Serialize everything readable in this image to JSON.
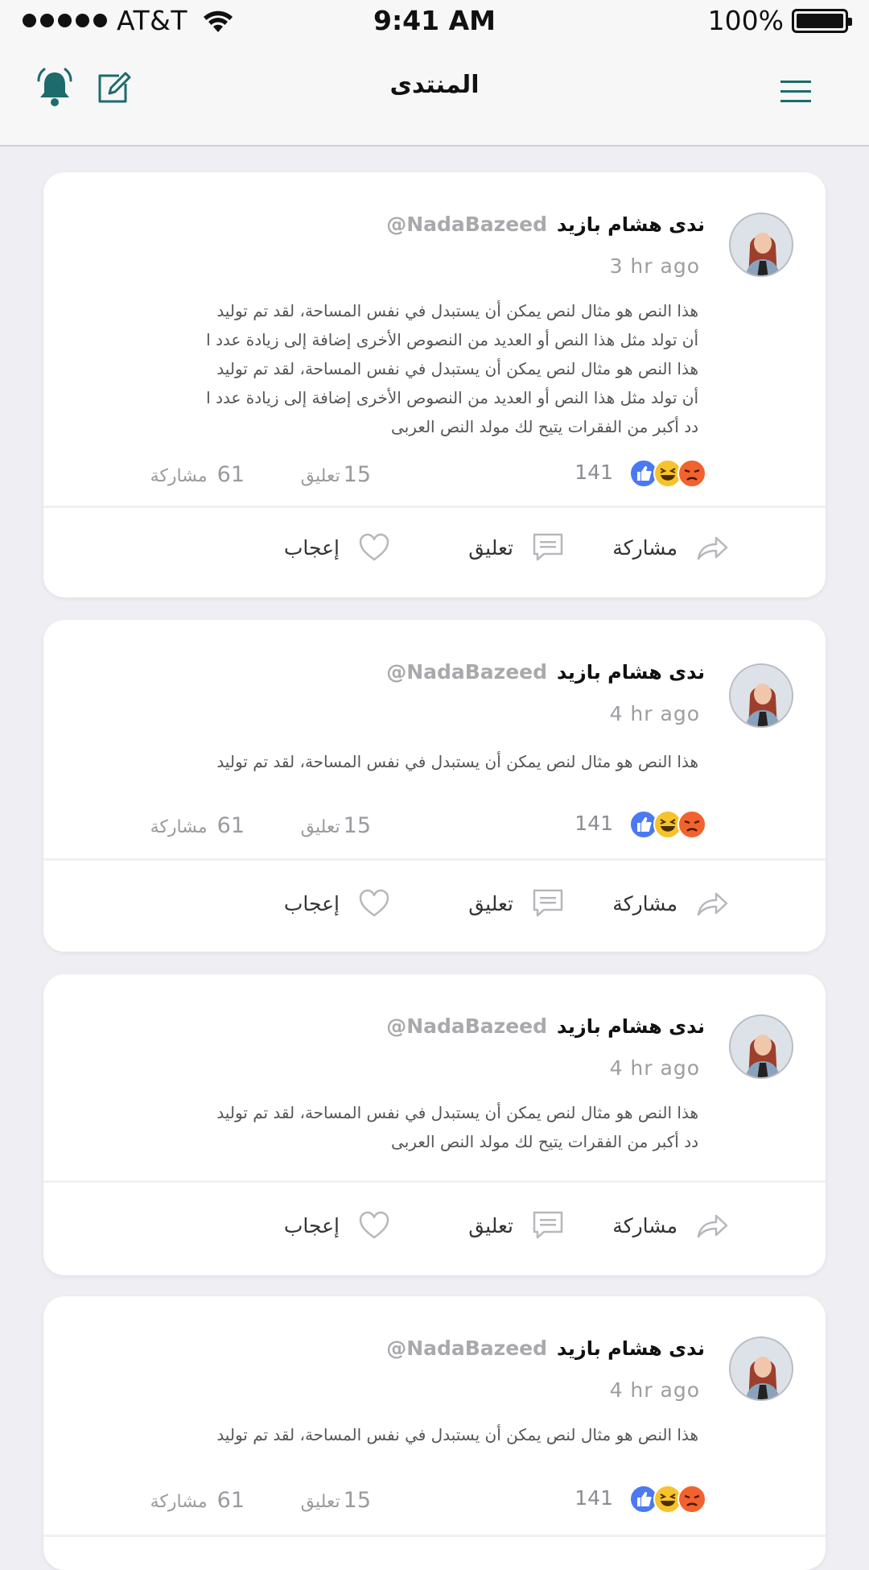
{
  "status_bar": {
    "carrier": "AT&T",
    "time": "9:41 AM",
    "battery": "100%"
  },
  "nav": {
    "title": "المنتدى",
    "accent_color": "#1d6b6b"
  },
  "labels": {
    "share_action": "مشاركة",
    "comment_action": "تعليق",
    "like_action": "إعجاب",
    "share_stat": "مشاركة",
    "comment_stat": "تعليق"
  },
  "posts": [
    {
      "author": "ندى هشام بازيد",
      "handle": "@NadaBazeed",
      "time": "3 hr ago",
      "lines": [
        "هذا النص هو مثال لنص يمكن أن يستبدل في نفس المساحة، لقد تم توليد",
        "أن تولد مثل هذا النص أو العديد من النصوص الأخرى إضافة إلى زيادة عدد ا",
        "هذا النص هو مثال لنص يمكن أن يستبدل في نفس المساحة، لقد تم توليد",
        "أن تولد مثل هذا النص أو العديد من النصوص الأخرى إضافة إلى زيادة عدد ا",
        "دد أكبر من الفقرات يتيح لك مولد النص العربى"
      ],
      "reactions": "141",
      "comments": "15",
      "shares": "61"
    },
    {
      "author": "ندى هشام بازيد",
      "handle": "@NadaBazeed",
      "time": "4 hr ago",
      "lines": [
        "هذا النص هو مثال لنص يمكن أن يستبدل في نفس المساحة، لقد تم توليد"
      ],
      "reactions": "141",
      "comments": "15",
      "shares": "61"
    },
    {
      "author": "ندى هشام بازيد",
      "handle": "@NadaBazeed",
      "time": "4 hr ago",
      "lines": [
        "هذا النص هو مثال لنص يمكن أن يستبدل في نفس المساحة، لقد تم توليد",
        "دد أكبر من الفقرات يتيح لك مولد النص العربى"
      ]
    },
    {
      "author": "ندى هشام بازيد",
      "handle": "@NadaBazeed",
      "time": "4 hr ago",
      "lines": [
        "هذا النص هو مثال لنص يمكن أن يستبدل في نفس المساحة، لقد تم توليد"
      ],
      "reactions": "141",
      "comments": "15",
      "shares": "61"
    }
  ]
}
